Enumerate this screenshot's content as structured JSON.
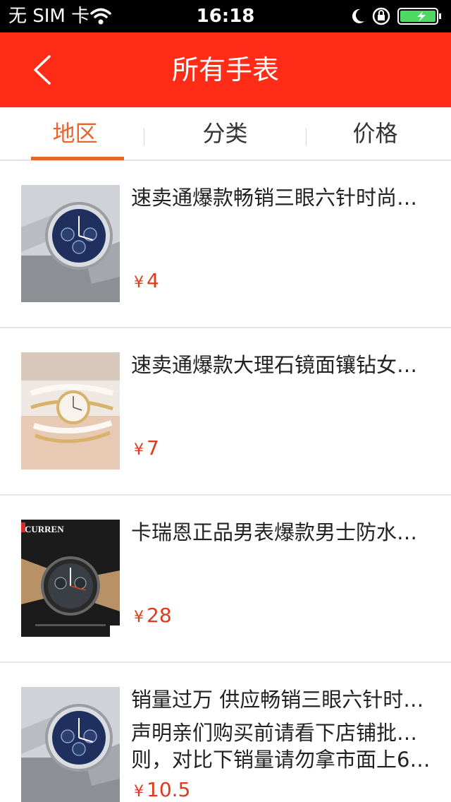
{
  "status_bar": {
    "carrier": "无 SIM 卡",
    "time": "16:18"
  },
  "nav": {
    "title": "所有手表"
  },
  "tabs": [
    {
      "label": "地区",
      "active": true
    },
    {
      "label": "分类",
      "active": false
    },
    {
      "label": "价格",
      "active": false
    }
  ],
  "currency_symbol": "¥",
  "products": [
    {
      "title": "速卖通爆款畅销三眼六针时尚钢…",
      "desc_line1": "",
      "desc_line2": "",
      "price": "4"
    },
    {
      "title": "速卖通爆款大理石镜面镶钻女式…",
      "desc_line1": "",
      "desc_line2": "",
      "price": "7"
    },
    {
      "title": "卡瑞恩正品男表爆款男士防水商…",
      "desc_line1": "",
      "desc_line2": "",
      "price": "28",
      "thumb_brand": "CURREN"
    },
    {
      "title": "销量过万 供应畅销三眼六针时尚…",
      "desc_line1": "声明亲们购买前请看下店铺批发规",
      "desc_line2": "则，对比下销量请勿拿市面上6…",
      "price": "10.5"
    }
  ],
  "colors": {
    "nav_bg": "#ff2d18",
    "accent": "#e8662e",
    "price": "#e03a1d"
  }
}
